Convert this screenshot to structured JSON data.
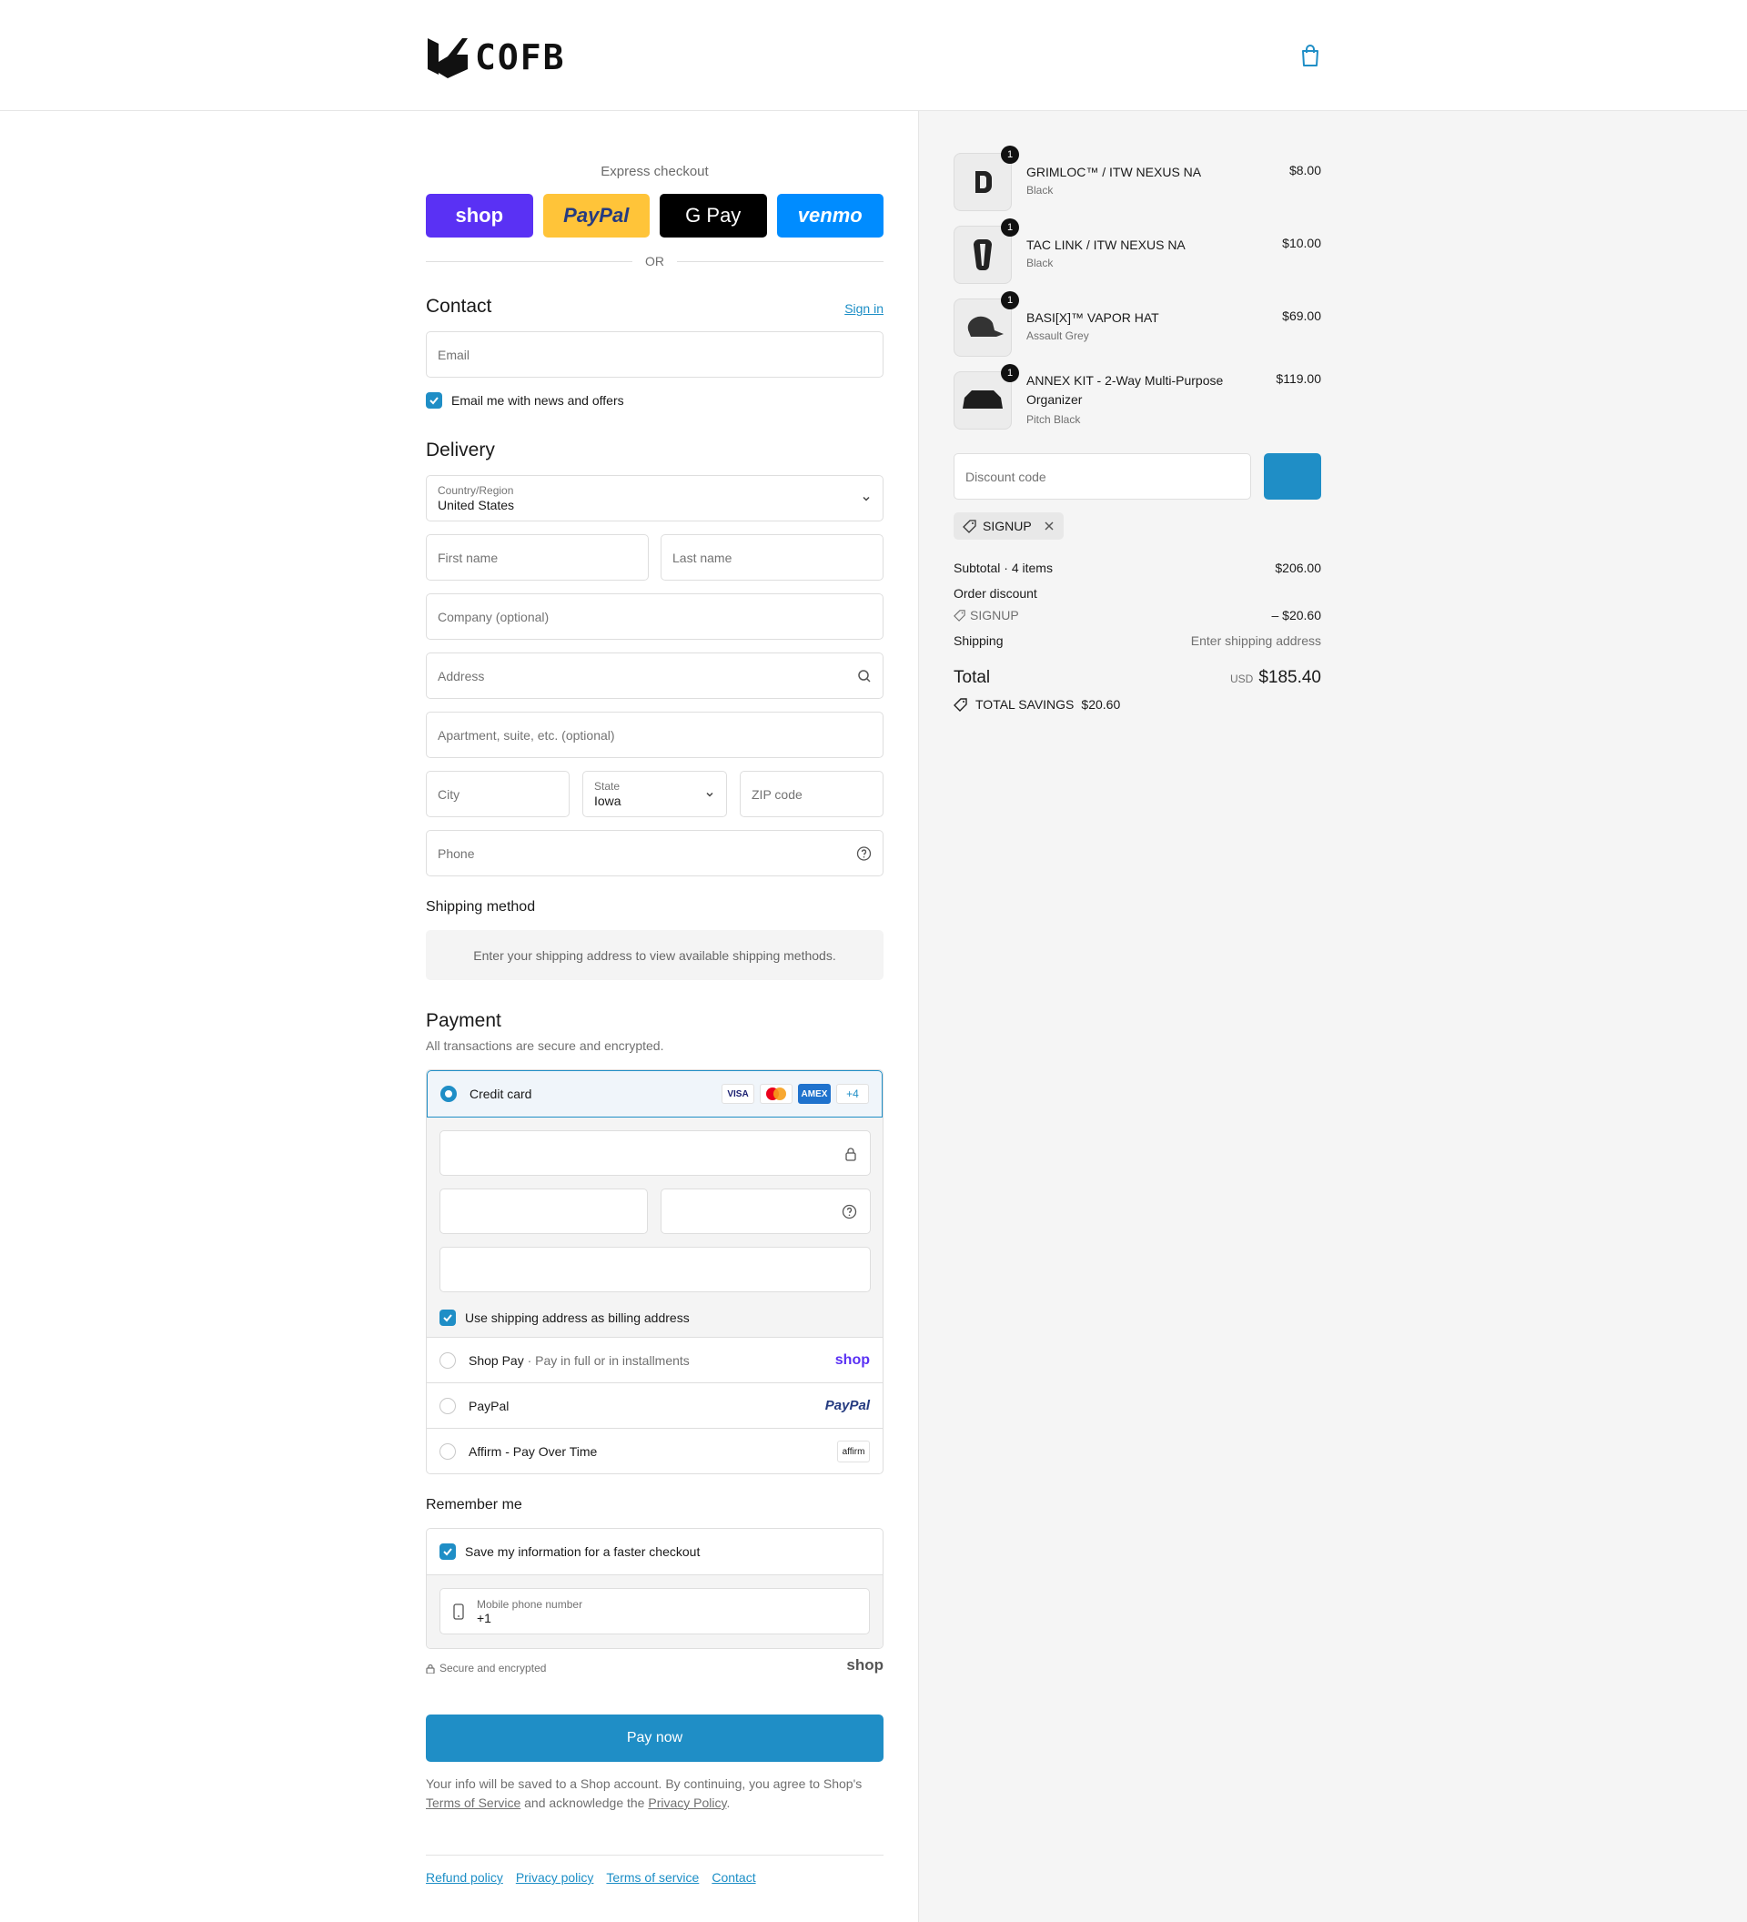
{
  "brand": {
    "logo_text": "COFB"
  },
  "express": {
    "title": "Express checkout",
    "buttons": {
      "shop": "shop",
      "paypal": "PayPal",
      "gpay": "G Pay",
      "venmo": "venmo"
    },
    "or": "OR"
  },
  "contact": {
    "title": "Contact",
    "sign_in": "Sign in",
    "email_placeholder": "Email",
    "news_label": "Email me with news and offers"
  },
  "delivery": {
    "title": "Delivery",
    "country_label": "Country/Region",
    "country_value": "United States",
    "first_name": "First name",
    "last_name": "Last name",
    "company": "Company (optional)",
    "address": "Address",
    "apartment": "Apartment, suite, etc. (optional)",
    "city": "City",
    "state_label": "State",
    "state_value": "Iowa",
    "zip": "ZIP code",
    "phone": "Phone"
  },
  "shipping_method": {
    "title": "Shipping method",
    "message": "Enter your shipping address to view available shipping methods."
  },
  "payment": {
    "title": "Payment",
    "subtitle": "All transactions are secure and encrypted.",
    "credit_card": "Credit card",
    "card_brands": [
      "VISA",
      "",
      "AMEX",
      "+4"
    ],
    "billing_label": "Use shipping address as billing address",
    "shop_pay": "Shop Pay",
    "shop_pay_sub": "Pay in full or in installments",
    "shop_logo": "shop",
    "paypal": "PayPal",
    "paypal_logo": "PayPal",
    "affirm": "Affirm - Pay Over Time",
    "affirm_logo": "affirm"
  },
  "remember": {
    "title": "Remember me",
    "save_label": "Save my information for a faster checkout",
    "mobile_label": "Mobile phone number",
    "mobile_value": "+1",
    "secure": "Secure and encrypted",
    "shop_logo": "shop"
  },
  "pay_now": "Pay now",
  "legal": {
    "text1": "Your info will be saved to a Shop account. By continuing, you agree to Shop's",
    "terms": "Terms of Service",
    "text2": "and acknowledge the",
    "privacy": "Privacy Policy",
    "text3": "."
  },
  "footer": [
    "Refund policy",
    "Privacy policy",
    "Terms of service",
    "Contact"
  ],
  "cart": {
    "items": [
      {
        "name": "GRIMLOC™ / ITW NEXUS NA",
        "variant": "Black",
        "price": "$8.00",
        "qty": "1"
      },
      {
        "name": "TAC LINK / ITW NEXUS NA",
        "variant": "Black",
        "price": "$10.00",
        "qty": "1"
      },
      {
        "name": "BASI[X]™ VAPOR HAT",
        "variant": "Assault Grey",
        "price": "$69.00",
        "qty": "1"
      },
      {
        "name": "ANNEX KIT - 2-Way Multi-Purpose Organizer",
        "variant": "Pitch Black",
        "price": "$119.00",
        "qty": "1"
      }
    ],
    "discount_placeholder": "Discount code",
    "applied_code": "SIGNUP",
    "subtotal_label": "Subtotal · 4 items",
    "subtotal_value": "$206.00",
    "order_discount_label": "Order discount",
    "discount_code": "SIGNUP",
    "discount_value": "– $20.60",
    "shipping_label": "Shipping",
    "shipping_value": "Enter shipping address",
    "total_label": "Total",
    "currency": "USD",
    "total_value": "$185.40",
    "savings_label": "TOTAL SAVINGS",
    "savings_value": "$20.60",
    "colors": {
      "accent": "#1f8ec6"
    }
  }
}
